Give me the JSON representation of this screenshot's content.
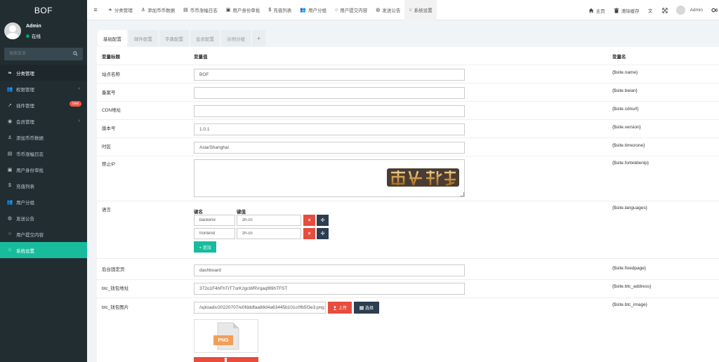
{
  "app": {
    "title": "BOF"
  },
  "user": {
    "name": "Admin",
    "status": "在线"
  },
  "search": {
    "placeholder": "搜索菜单"
  },
  "sidebar": {
    "items": [
      {
        "label": "分类管理",
        "icon": "leaf-icon",
        "glyph": "❧"
      },
      {
        "label": "权限管理",
        "icon": "users-icon",
        "glyph": "👥",
        "chevron": "‹"
      },
      {
        "label": "插件管理",
        "icon": "rocket-icon",
        "glyph": "➚",
        "badge": "new"
      },
      {
        "label": "会员管理",
        "icon": "user-circle-icon",
        "glyph": "◉",
        "chevron": "‹"
      },
      {
        "label": "添加币币数据",
        "icon": "anchor-icon",
        "glyph": "⚓"
      },
      {
        "label": "币币涨幅日志",
        "icon": "list-icon",
        "glyph": "▤"
      },
      {
        "label": "用户身份审批",
        "icon": "id-card-icon",
        "glyph": "▣"
      },
      {
        "label": "充值列表",
        "icon": "dollar-icon",
        "glyph": "$"
      },
      {
        "label": "用户分组",
        "icon": "group-icon",
        "glyph": "👥"
      },
      {
        "label": "发送公告",
        "icon": "globe-icon",
        "glyph": "◍"
      },
      {
        "label": "用户提交内容",
        "icon": "circle-icon",
        "glyph": "○"
      },
      {
        "label": "系统设置",
        "icon": "circle-icon",
        "glyph": "○"
      }
    ]
  },
  "topbar": {
    "menu_glyph": "≡",
    "items": [
      {
        "label": "分类管理",
        "glyph": "❧"
      },
      {
        "label": "添加币币数据",
        "glyph": "⚓"
      },
      {
        "label": "币币涨幅日志",
        "glyph": "▤"
      },
      {
        "label": "用户身份审批",
        "glyph": "▣"
      },
      {
        "label": "充值列表",
        "glyph": "$"
      },
      {
        "label": "用户分组",
        "glyph": "👥"
      },
      {
        "label": "用户提交内容",
        "glyph": "○"
      },
      {
        "label": "发送公告",
        "glyph": "◍"
      },
      {
        "label": "系统设置",
        "glyph": "○"
      }
    ],
    "home": "主页",
    "clear_cache": "清除缓存",
    "admin": "Admin"
  },
  "tabs": [
    "基础配置",
    "邮件配置",
    "字典配置",
    "会员配置",
    "示例分组",
    "+"
  ],
  "table": {
    "col_title": "变量标题",
    "col_value": "变量值",
    "col_name": "变量名",
    "rows": [
      {
        "label": "站点名称",
        "value": "BOF",
        "name": "{$site.name}"
      },
      {
        "label": "备案号",
        "value": "",
        "name": "{$site.beian}"
      },
      {
        "label": "CDN地址",
        "value": "",
        "name": "{$site.cdnurl}"
      },
      {
        "label": "版本号",
        "value": "1.0.1",
        "name": "{$site.version}"
      },
      {
        "label": "时区",
        "value": "Asia/Shanghai",
        "name": "{$site.timezone}"
      },
      {
        "label": "禁止IP",
        "value": "",
        "name": "{$site.forbiddenip}"
      },
      {
        "label": "语言",
        "name": "{$site.languages}"
      },
      {
        "label": "后台固定页",
        "value": "dashboard",
        "name": "{$site.fixedpage}"
      },
      {
        "label": "btc_钱包地址",
        "value": "372o1F4hFhTrT7orKzgcWRVqaqf89hTFST",
        "name": "{$site.btc_address}"
      },
      {
        "label": "btc_钱包图片",
        "value": "/uploads/20220707/e0fdddfaa88d4a63445b101c0fb5f3e3.png",
        "name": "{$site.btc_image}"
      }
    ]
  },
  "languages": {
    "key_header": "键名",
    "value_header": "键值",
    "entries": [
      {
        "key": "backend",
        "value": "zh-cn"
      },
      {
        "key": "frontend",
        "value": "zh-cn"
      }
    ],
    "add_label": "+ 追加",
    "remove_glyph": "×",
    "drag_glyph": "✣"
  },
  "upload": {
    "upload_label": "上传",
    "select_label": "选择",
    "file_badge": "PNG"
  },
  "colors": {
    "sidebar_bg": "#222d32",
    "accent": "#18bc9c",
    "danger": "#e74c3c",
    "dark": "#2c3e50"
  }
}
